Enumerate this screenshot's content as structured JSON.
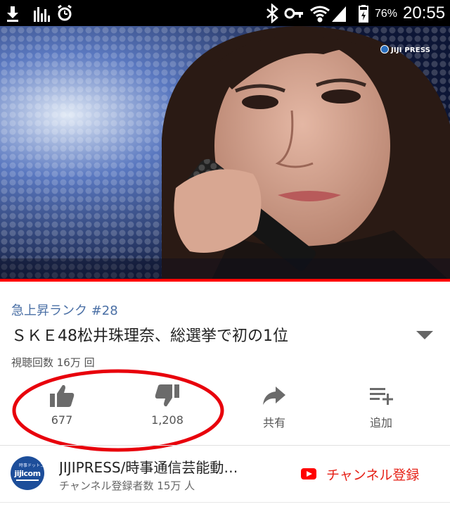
{
  "status_bar": {
    "battery_percent": "76%",
    "time": "20:55",
    "icons_left": [
      "download-icon",
      "equalizer-icon",
      "alarm-icon"
    ],
    "icons_right": [
      "bluetooth-icon",
      "key-icon",
      "wifi-icon",
      "cellular-signal-icon",
      "battery-icon"
    ]
  },
  "video": {
    "watermark": "JIJI PRESS",
    "progress": 1.0,
    "progress_color": "#ff0000"
  },
  "info": {
    "rank": "急上昇ランク #28",
    "title": "ＳＫＥ48松井珠理奈、総選挙で初の1位",
    "views": "視聴回数 16万 回"
  },
  "actions": [
    {
      "icon": "thumbs-up-icon",
      "label": "677"
    },
    {
      "icon": "thumbs-down-icon",
      "label": "1,208"
    },
    {
      "icon": "share-icon",
      "label": "共有"
    },
    {
      "icon": "add-to-playlist-icon",
      "label": "追加"
    }
  ],
  "channel": {
    "name": "JIJIPRESS/時事通信芸能動…",
    "subscribers": "チャンネル登録者数 15万 人",
    "subscribe_label": "チャンネル登録",
    "avatar_text": "jijicom",
    "avatar_small_text": "時事ドットコム"
  },
  "colors": {
    "accent_red": "#ff0000",
    "subscribe_red": "#e62117",
    "rank_blue": "#4a6fa5",
    "annotation_red": "#e8000b"
  }
}
